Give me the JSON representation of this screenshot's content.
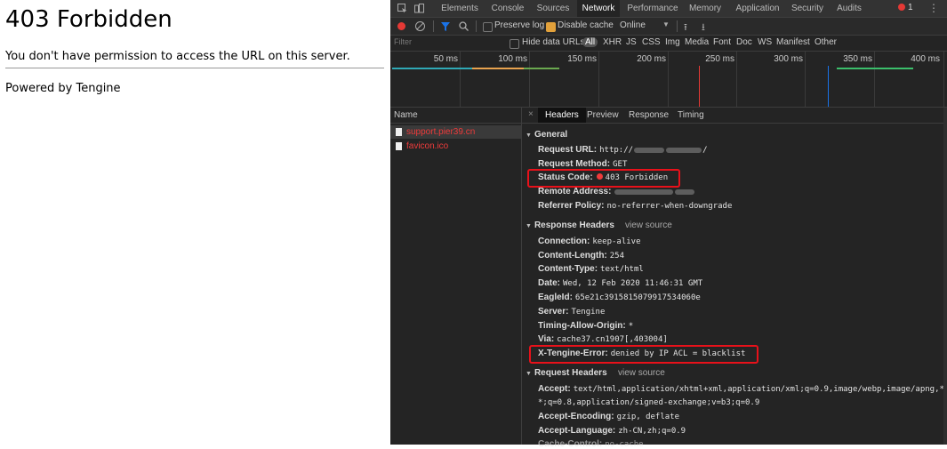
{
  "page": {
    "title": "403 Forbidden",
    "message": "You don't have permission to access the URL on this server.",
    "powered": "Powered by Tengine"
  },
  "devtools": {
    "tabs": [
      "Elements",
      "Console",
      "Sources",
      "Network",
      "Performance",
      "Memory",
      "Application",
      "Security",
      "Audits"
    ],
    "active_tab": "Network",
    "error_count": "1",
    "toolbar": {
      "preserve_log": "Preserve log",
      "disable_cache": "Disable cache",
      "throttle": "Online"
    },
    "filter": {
      "placeholder": "Filter",
      "hide_data_urls": "Hide data URLs",
      "types": [
        "All",
        "XHR",
        "JS",
        "CSS",
        "Img",
        "Media",
        "Font",
        "Doc",
        "WS",
        "Manifest",
        "Other"
      ]
    },
    "timeline": {
      "ticks": [
        "50 ms",
        "100 ms",
        "150 ms",
        "200 ms",
        "250 ms",
        "300 ms",
        "350 ms",
        "400 ms"
      ]
    },
    "requests": {
      "header": "Name",
      "items": [
        "support.pier39.cn",
        "favicon.ico"
      ]
    },
    "detail": {
      "tabs": [
        "Headers",
        "Preview",
        "Response",
        "Timing"
      ],
      "close": "×",
      "general": {
        "title": "General",
        "request_url_key": "Request URL:",
        "request_url_val_prefix": "http://",
        "request_url_val_suffix": "/",
        "request_method_key": "Request Method:",
        "request_method_val": "GET",
        "status_code_key": "Status Code:",
        "status_code_val": "403 Forbidden",
        "remote_address_key": "Remote Address:",
        "referrer_key": "Referrer Policy:",
        "referrer_val": "no-referrer-when-downgrade"
      },
      "response_headers": {
        "title": "Response Headers",
        "view_source": "view source",
        "rows": [
          {
            "k": "Connection:",
            "v": "keep-alive"
          },
          {
            "k": "Content-Length:",
            "v": "254"
          },
          {
            "k": "Content-Type:",
            "v": "text/html"
          },
          {
            "k": "Date:",
            "v": "Wed, 12 Feb 2020 11:46:31 GMT"
          },
          {
            "k": "EagleId:",
            "v": "65e21c3915815079917534060e"
          },
          {
            "k": "Server:",
            "v": "Tengine"
          },
          {
            "k": "Timing-Allow-Origin:",
            "v": "*"
          },
          {
            "k": "Via:",
            "v": "cache37.cn1907[,403004]"
          },
          {
            "k": "X-Tengine-Error:",
            "v": "denied by IP ACL = blacklist"
          }
        ]
      },
      "request_headers": {
        "title": "Request Headers",
        "view_source": "view source",
        "accept_key": "Accept:",
        "accept_val": "text/html,application/xhtml+xml,application/xml;q=0.9,image/webp,image/apng,*/",
        "accept_val_cont": "*;q=0.8,application/signed-exchange;v=b3;q=0.9",
        "accept_encoding_key": "Accept-Encoding:",
        "accept_encoding_val": "gzip, deflate",
        "accept_language_key": "Accept-Language:",
        "accept_language_val": "zh-CN,zh;q=0.9",
        "cache_control_key": "Cache-Control:",
        "cache_control_val": "no-cache"
      }
    },
    "colors": {
      "error_red": "#e8111a",
      "accent": "#1a73e8",
      "disable_cache_check": "#e2a13b"
    }
  }
}
